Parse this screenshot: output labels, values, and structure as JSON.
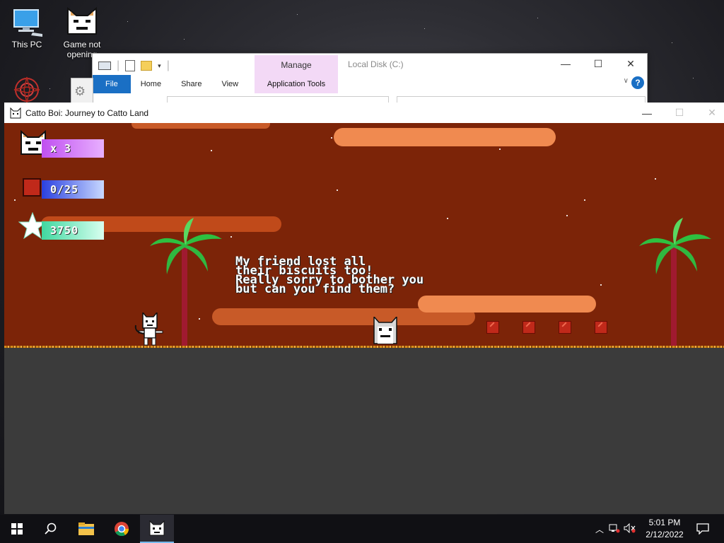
{
  "desktop": {
    "icons": [
      {
        "label": "This PC"
      },
      {
        "label": "Game not opening"
      }
    ]
  },
  "explorer": {
    "manage_label": "Manage",
    "app_tools_label": "Application Tools",
    "title": "Local Disk (C:)",
    "tabs": [
      "File",
      "Home",
      "Share",
      "View"
    ],
    "help": "?"
  },
  "game": {
    "title": "Catto Boi: Journey to Catto Land",
    "hud": {
      "lives": "x 3",
      "biscuits": "0/25",
      "score": "3750"
    },
    "dialog_lines": [
      "My friend lost all",
      "their biscuits too!",
      "Really sorry to bother you",
      "but can you find them?"
    ],
    "colors": {
      "sky": "#7c2408",
      "cloud": "#e87a3c",
      "ground": "#d68e1c",
      "floor": "#3b3b3b"
    }
  },
  "taskbar": {
    "time": "5:01 PM",
    "date": "2/12/2022",
    "items": [
      "start-icon",
      "search-icon",
      "file-explorer-icon",
      "chrome-icon",
      "catto-boi-icon"
    ]
  }
}
